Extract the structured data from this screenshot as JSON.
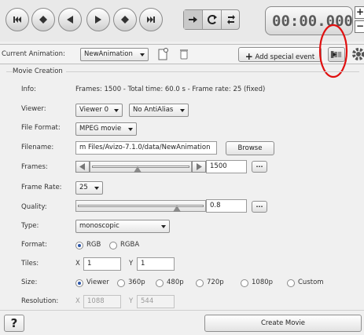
{
  "transport": {
    "time": "00:00.000",
    "plus": "+",
    "minus": "−"
  },
  "animation_bar": {
    "label": "Current Animation:",
    "selected": "NewAnimation",
    "add_event_label": "Add special event",
    "add_event_plus": "+"
  },
  "panel": {
    "group_title": "Movie Creation",
    "info_label": "Info:",
    "info_value": "Frames: 1500 - Total time: 60.0 s - Frame rate: 25 (fixed)",
    "viewer_label": "Viewer:",
    "viewer_value": "Viewer 0",
    "antialias_value": "No AntiAlias",
    "format_file_label": "File Format:",
    "format_file_value": "MPEG movie",
    "filename_label": "Filename:",
    "filename_value": "m Files/Avizo-7.1.0/data/NewAnimation",
    "browse_label": "Browse",
    "frames_label": "Frames:",
    "frames_value": "1500",
    "frames_slider_level": 0.47,
    "framerate_label": "Frame Rate:",
    "framerate_value": "25",
    "quality_label": "Quality:",
    "quality_value": "0.8",
    "quality_slider_level": 0.8,
    "type_label": "Type:",
    "type_value": "monoscopic",
    "format_label": "Format:",
    "format_options": [
      "RGB",
      "RGBA"
    ],
    "format_selected": "RGB",
    "tiles_label": "Tiles:",
    "tiles_x_label": "X",
    "tiles_x": "1",
    "tiles_y_label": "Y",
    "tiles_y": "1",
    "size_label": "Size:",
    "size_options": [
      "Viewer",
      "360p",
      "480p",
      "720p",
      "1080p",
      "Custom"
    ],
    "size_selected": "Viewer",
    "resolution_label": "Resolution:",
    "res_x_label": "X",
    "res_x": "1088",
    "res_y_label": "Y",
    "res_y": "544",
    "dots": "..."
  },
  "footer": {
    "help_label": "?",
    "create_label": "Create Movie"
  },
  "colors": {
    "annotation": "#e01010"
  }
}
